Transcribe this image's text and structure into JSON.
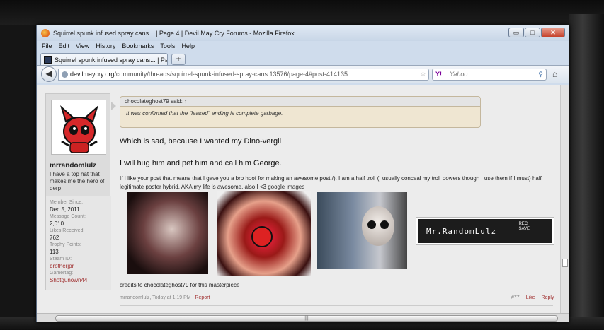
{
  "window": {
    "title": "Squirrel spunk infused spray cans... | Page 4 | Devil May Cry Forums - Mozilla Firefox",
    "controls": {
      "minimize": "▭",
      "maximize": "□",
      "close": "✕"
    }
  },
  "menu": [
    "File",
    "Edit",
    "View",
    "History",
    "Bookmarks",
    "Tools",
    "Help"
  ],
  "tabs": [
    {
      "label": "Squirrel spunk infused spray cans... | Pag..."
    }
  ],
  "new_tab": "+",
  "nav": {
    "back": "◀",
    "url_domain": "devilmaycry.org",
    "url_path": "/community/threads/squirrel-spunk-infused-spray-cans.13576/page-4#post-414135",
    "search_engine": "Y!",
    "search_placeholder": "Yahoo",
    "star": "☆",
    "reload": "↻",
    "search_icon": "⚲",
    "home": "⌂"
  },
  "user": {
    "name": "mrrandomlulz",
    "title": "I have a top hat that makes me the hero of derp",
    "stats": [
      {
        "label": "Member Since:",
        "value": "Dec 5, 2011"
      },
      {
        "label": "Message Count:",
        "value": "2,010"
      },
      {
        "label": "Likes Received:",
        "value": "762"
      },
      {
        "label": "Trophy Points:",
        "value": "113"
      },
      {
        "label": "Steam ID:",
        "value": "brotherjpr"
      },
      {
        "label": "Gamertag:",
        "value": "Shotgunown44"
      }
    ]
  },
  "post": {
    "quote_author": "chocolateghost79 said: ↑",
    "quote_text": "It was confirmed that the \"leaked\" ending is complete garbage.",
    "line1": "Which is sad, because I wanted my Dino-vergil",
    "line2": "I will hug him and pet him and call him George.",
    "signature": "If I like your post that means that I gave you a bro hoof for making an awesome post /). I am a half troll (I usually conceal my troll powers though I use them if I must) half legitimate poster hybrid. AKA my life is awesome, also I <3 google images",
    "sig_banner": "Mr.RandomLulz",
    "sig_banner_rec": "REC",
    "sig_banner_save": "SAVE",
    "credits": "credits to chocolateghost79 for this masterpiece",
    "footer_author": "mrrandomlulz, Today at 1:19 PM",
    "report": "Report",
    "post_number": "#77",
    "like": "Like",
    "reply": "Reply"
  },
  "scroll": {
    "h_grip": "|||"
  }
}
